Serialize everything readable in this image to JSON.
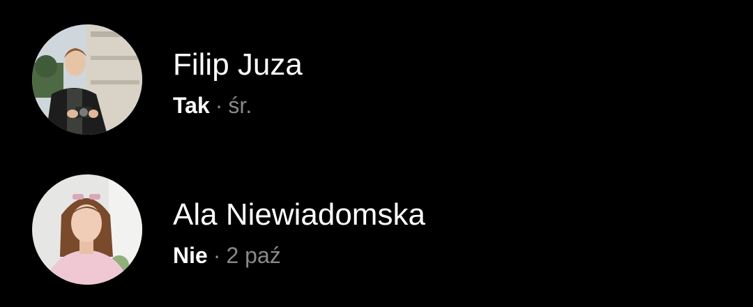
{
  "colors": {
    "background": "#000000",
    "name": "#ffffff",
    "status": "#ffffff",
    "secondary": "#8a8a8a"
  },
  "people": [
    {
      "name": "Filip Juza",
      "status": "Tak",
      "separator": "·",
      "time": "śr.",
      "avatar_icon": "avatar-photo-man-with-camera"
    },
    {
      "name": "Ala Niewiadomska",
      "status": "Nie",
      "separator": "·",
      "time": "2 paź",
      "avatar_icon": "avatar-photo-woman-with-sunglasses"
    }
  ]
}
